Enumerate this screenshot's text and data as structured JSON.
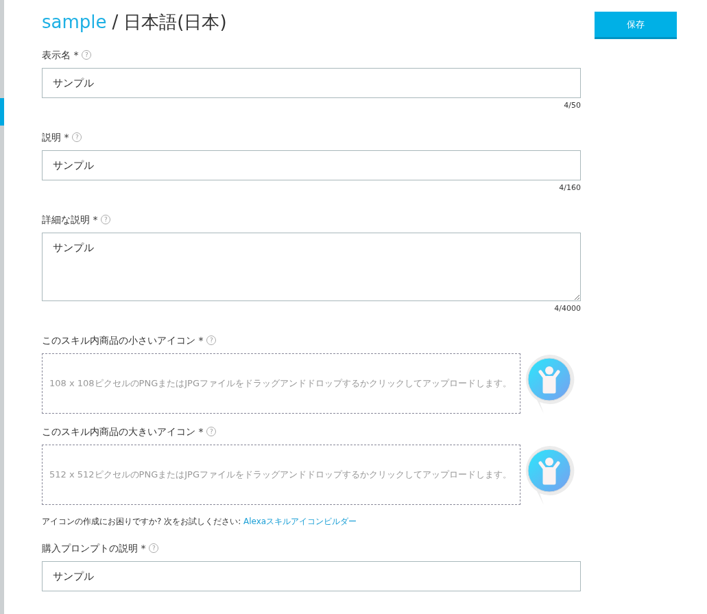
{
  "title": {
    "project": "sample",
    "separator": "/",
    "locale": "日本語(日本)"
  },
  "save_button": {
    "label": "保存"
  },
  "fields": [
    {
      "kind": "text",
      "label": "表示名 *",
      "help": "?",
      "value": "サンプル",
      "counter": "4/50"
    },
    {
      "kind": "text",
      "label": "説明 *",
      "help": "?",
      "value": "サンプル",
      "counter": "4/160"
    },
    {
      "kind": "textarea",
      "label": "詳細な説明 *",
      "help": "?",
      "value": "サンプル",
      "counter": "4/4000"
    },
    {
      "kind": "upload",
      "label": "このスキル内商品の小さいアイコン *",
      "help": "?",
      "placeholder": "108 x 108ピクセルのPNGまたはJPGファイルをドラッグアンドドロップするかクリックしてアップロードします。"
    },
    {
      "kind": "upload",
      "label": "このスキル内商品の大きいアイコン *",
      "help": "?",
      "placeholder": "512 x 512ピクセルのPNGまたはJPGファイルをドラッグアンドドロップするかクリックしてアップロードします。"
    },
    {
      "kind": "hint",
      "text": "アイコンの作成にお困りですか? 次をお試しください:",
      "link": "Alexaスキルアイコンビルダー"
    },
    {
      "kind": "text",
      "label": "購入プロンプトの説明 *",
      "help": "?",
      "value": "サンプル"
    }
  ]
}
